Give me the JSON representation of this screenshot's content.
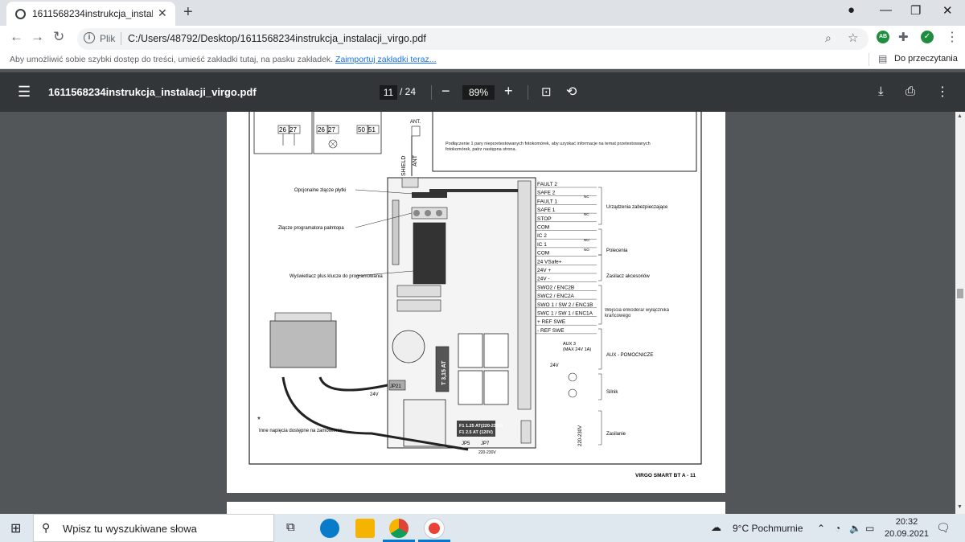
{
  "browser": {
    "tab_title": "1611568234instrukcja_instalacji_virgo.pdf",
    "new_tab": "+",
    "scheme_label": "Plik",
    "url": "C:/Users/48792/Desktop/1611568234instrukcja_instalacji_virgo.pdf",
    "bookmarks_message": "Aby umożliwić sobie szybki dostęp do treści, umieść zakładki tutaj, na pasku zakładek.",
    "bookmarks_link": "Zaimportuj zakładki teraz...",
    "reading_list": "Do przeczytania",
    "extension_badge": "AB"
  },
  "pdf_toolbar": {
    "file_name": "1611568234instrukcja_instalacji_virgo.pdf",
    "current_page": "11",
    "total_pages": "/ 24",
    "zoom": "89%"
  },
  "document": {
    "top_note": "Podłączenie 1 pary nieprzetestowanych fotokomórek, aby uzyskać informacje na temat przetestowanych fotokomórek, patrz następna strona.",
    "ant": "ANT.",
    "shield": "SHIELD",
    "ant_small": "ANT",
    "terminals_top": [
      "26",
      "27",
      "26",
      "27",
      "50",
      "51"
    ],
    "label_connector": "Opcjonalne złącze płytki",
    "label_programmer": "Złącze programatora palmtopa",
    "label_display": "Wyświetlacz plus klucze do programowania",
    "label_voltages": "Inne napięcia dostępne na zamówienie",
    "fuse_main": "T 3,15 AT",
    "fuse_f1a": "F1  1.25 AT(220-230V)",
    "fuse_f1b": "F1  2.5 AT (120V)",
    "jp21": "JP21",
    "jp5": "JP5",
    "jp7": "JP7",
    "v24": "24V",
    "v230": "220-230V",
    "terminal_labels": [
      "FAULT 2",
      "SAFE 2",
      "FAULT 1",
      "SAFE 1",
      "STOP",
      "COM",
      "IC 2",
      "IC 1",
      "COM",
      "24 VSafe+",
      "24V +",
      "24V -",
      "SWO2 / ENC2B",
      "SWC2 / ENC2A",
      "SWO 1 / SW 2 / ENC1B",
      "SWC 1 / SW 1 / ENC1A",
      "+ REF SWE",
      "- REF SWE"
    ],
    "group_safety": "Urządzenia zabezpieczające",
    "group_commands": "Polecenia",
    "group_power_acc": "Zasilacz akcesoriów",
    "group_encoder": "Wejścia enkodera/ wyłącznika krańcowego",
    "group_aux": "AUX - POMOCNICZE",
    "group_motor": "Silnik",
    "group_supply": "Zasilanie",
    "aux3": "AUX 3",
    "aux3_max": "(MAX 24V 1A)",
    "aux_24v": "24V",
    "nc": "NC",
    "no": "NO",
    "supply_v": "220-230V",
    "footer": "VIRGO SMART BT A - 11"
  },
  "taskbar": {
    "search_placeholder": "Wpisz tu wyszukiwane słowa",
    "weather": "9°C  Pochmurnie",
    "time": "20:32",
    "date": "20.09.2021"
  }
}
